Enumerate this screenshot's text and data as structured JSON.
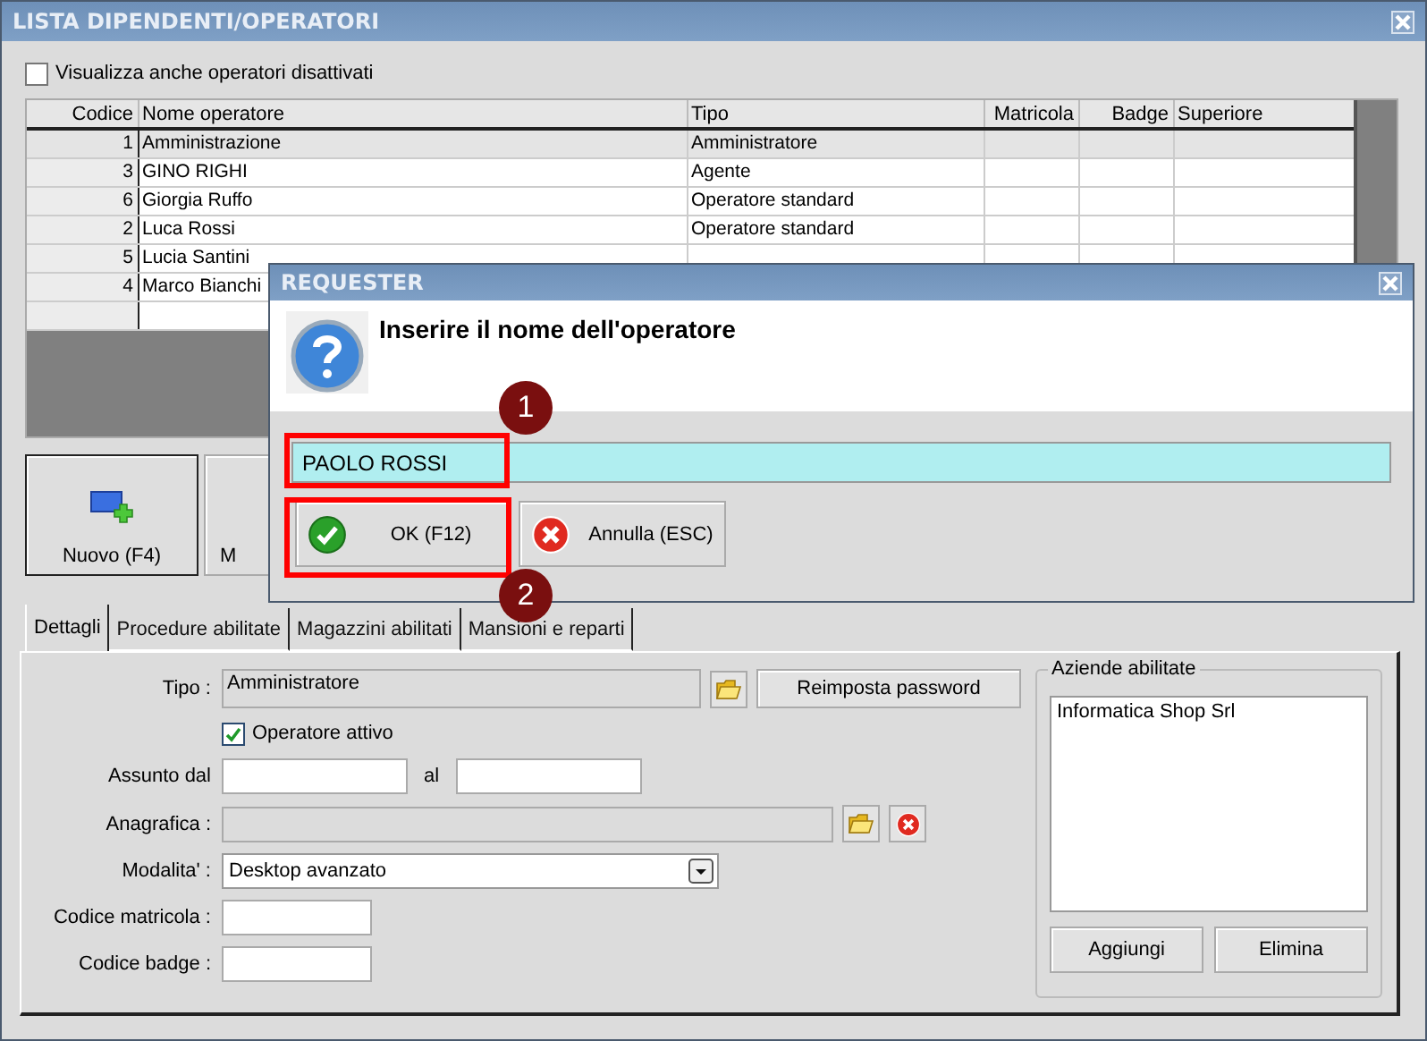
{
  "window": {
    "title": "LISTA DIPENDENTI/OPERATORI"
  },
  "show_disabled": {
    "label": "Visualizza anche operatori disattivati",
    "checked": false
  },
  "table": {
    "columns": [
      "Codice",
      "Nome operatore",
      "Tipo",
      "Matricola",
      "Badge",
      "Superiore"
    ],
    "rows": [
      {
        "code": "1",
        "name": "Amministrazione",
        "type": "Amministratore",
        "selected": true
      },
      {
        "code": "3",
        "name": "GINO RIGHI",
        "type": "Agente",
        "selected": false
      },
      {
        "code": "6",
        "name": "Giorgia Ruffo",
        "type": "Operatore standard",
        "selected": false
      },
      {
        "code": "2",
        "name": "Luca Rossi",
        "type": "Operatore standard",
        "selected": false
      },
      {
        "code": "5",
        "name": "Lucia Santini",
        "selected": false
      },
      {
        "code": "4",
        "name": "Marco Bianchi",
        "selected": false
      }
    ]
  },
  "actions": [
    {
      "label": "Nuovo (F4)",
      "kind": "new",
      "focused": true
    },
    {
      "label": "M",
      "kind": "other",
      "focused": false
    }
  ],
  "tabs": [
    {
      "label": "Dettagli",
      "selected": true
    },
    {
      "label": "Procedure abilitate",
      "selected": false
    },
    {
      "label": "Magazzini abilitati",
      "selected": false
    },
    {
      "label": "Mansioni e reparti",
      "selected": false
    }
  ],
  "form": {
    "tipo": {
      "label": "Tipo :",
      "value": "Amministratore"
    },
    "reset_password": "Reimposta password",
    "active": {
      "label": "Operatore attivo",
      "checked": true
    },
    "hired": {
      "label": "Assunto dal",
      "to_label": "al"
    },
    "anagrafica": {
      "label": "Anagrafica :"
    },
    "mode": {
      "label": "Modalita' :",
      "value": "Desktop avanzato"
    },
    "matricola": {
      "label": "Codice matricola :"
    },
    "badge": {
      "label": "Codice badge :"
    }
  },
  "companies": {
    "title": "Aziende abilitate",
    "items": [
      "Informatica Shop Srl"
    ],
    "buttons": [
      "Aggiungi",
      "Elimina"
    ]
  },
  "dialog": {
    "title": "REQUESTER",
    "message": "Inserire il nome dell'operatore",
    "value": "PAOLO ROSSI",
    "buttons": [
      {
        "label": "OK (F12)",
        "kind": "ok"
      },
      {
        "label": "Annulla (ESC)",
        "kind": "cancel"
      }
    ]
  },
  "callouts": [
    {
      "number": "1"
    },
    {
      "number": "2"
    }
  ]
}
